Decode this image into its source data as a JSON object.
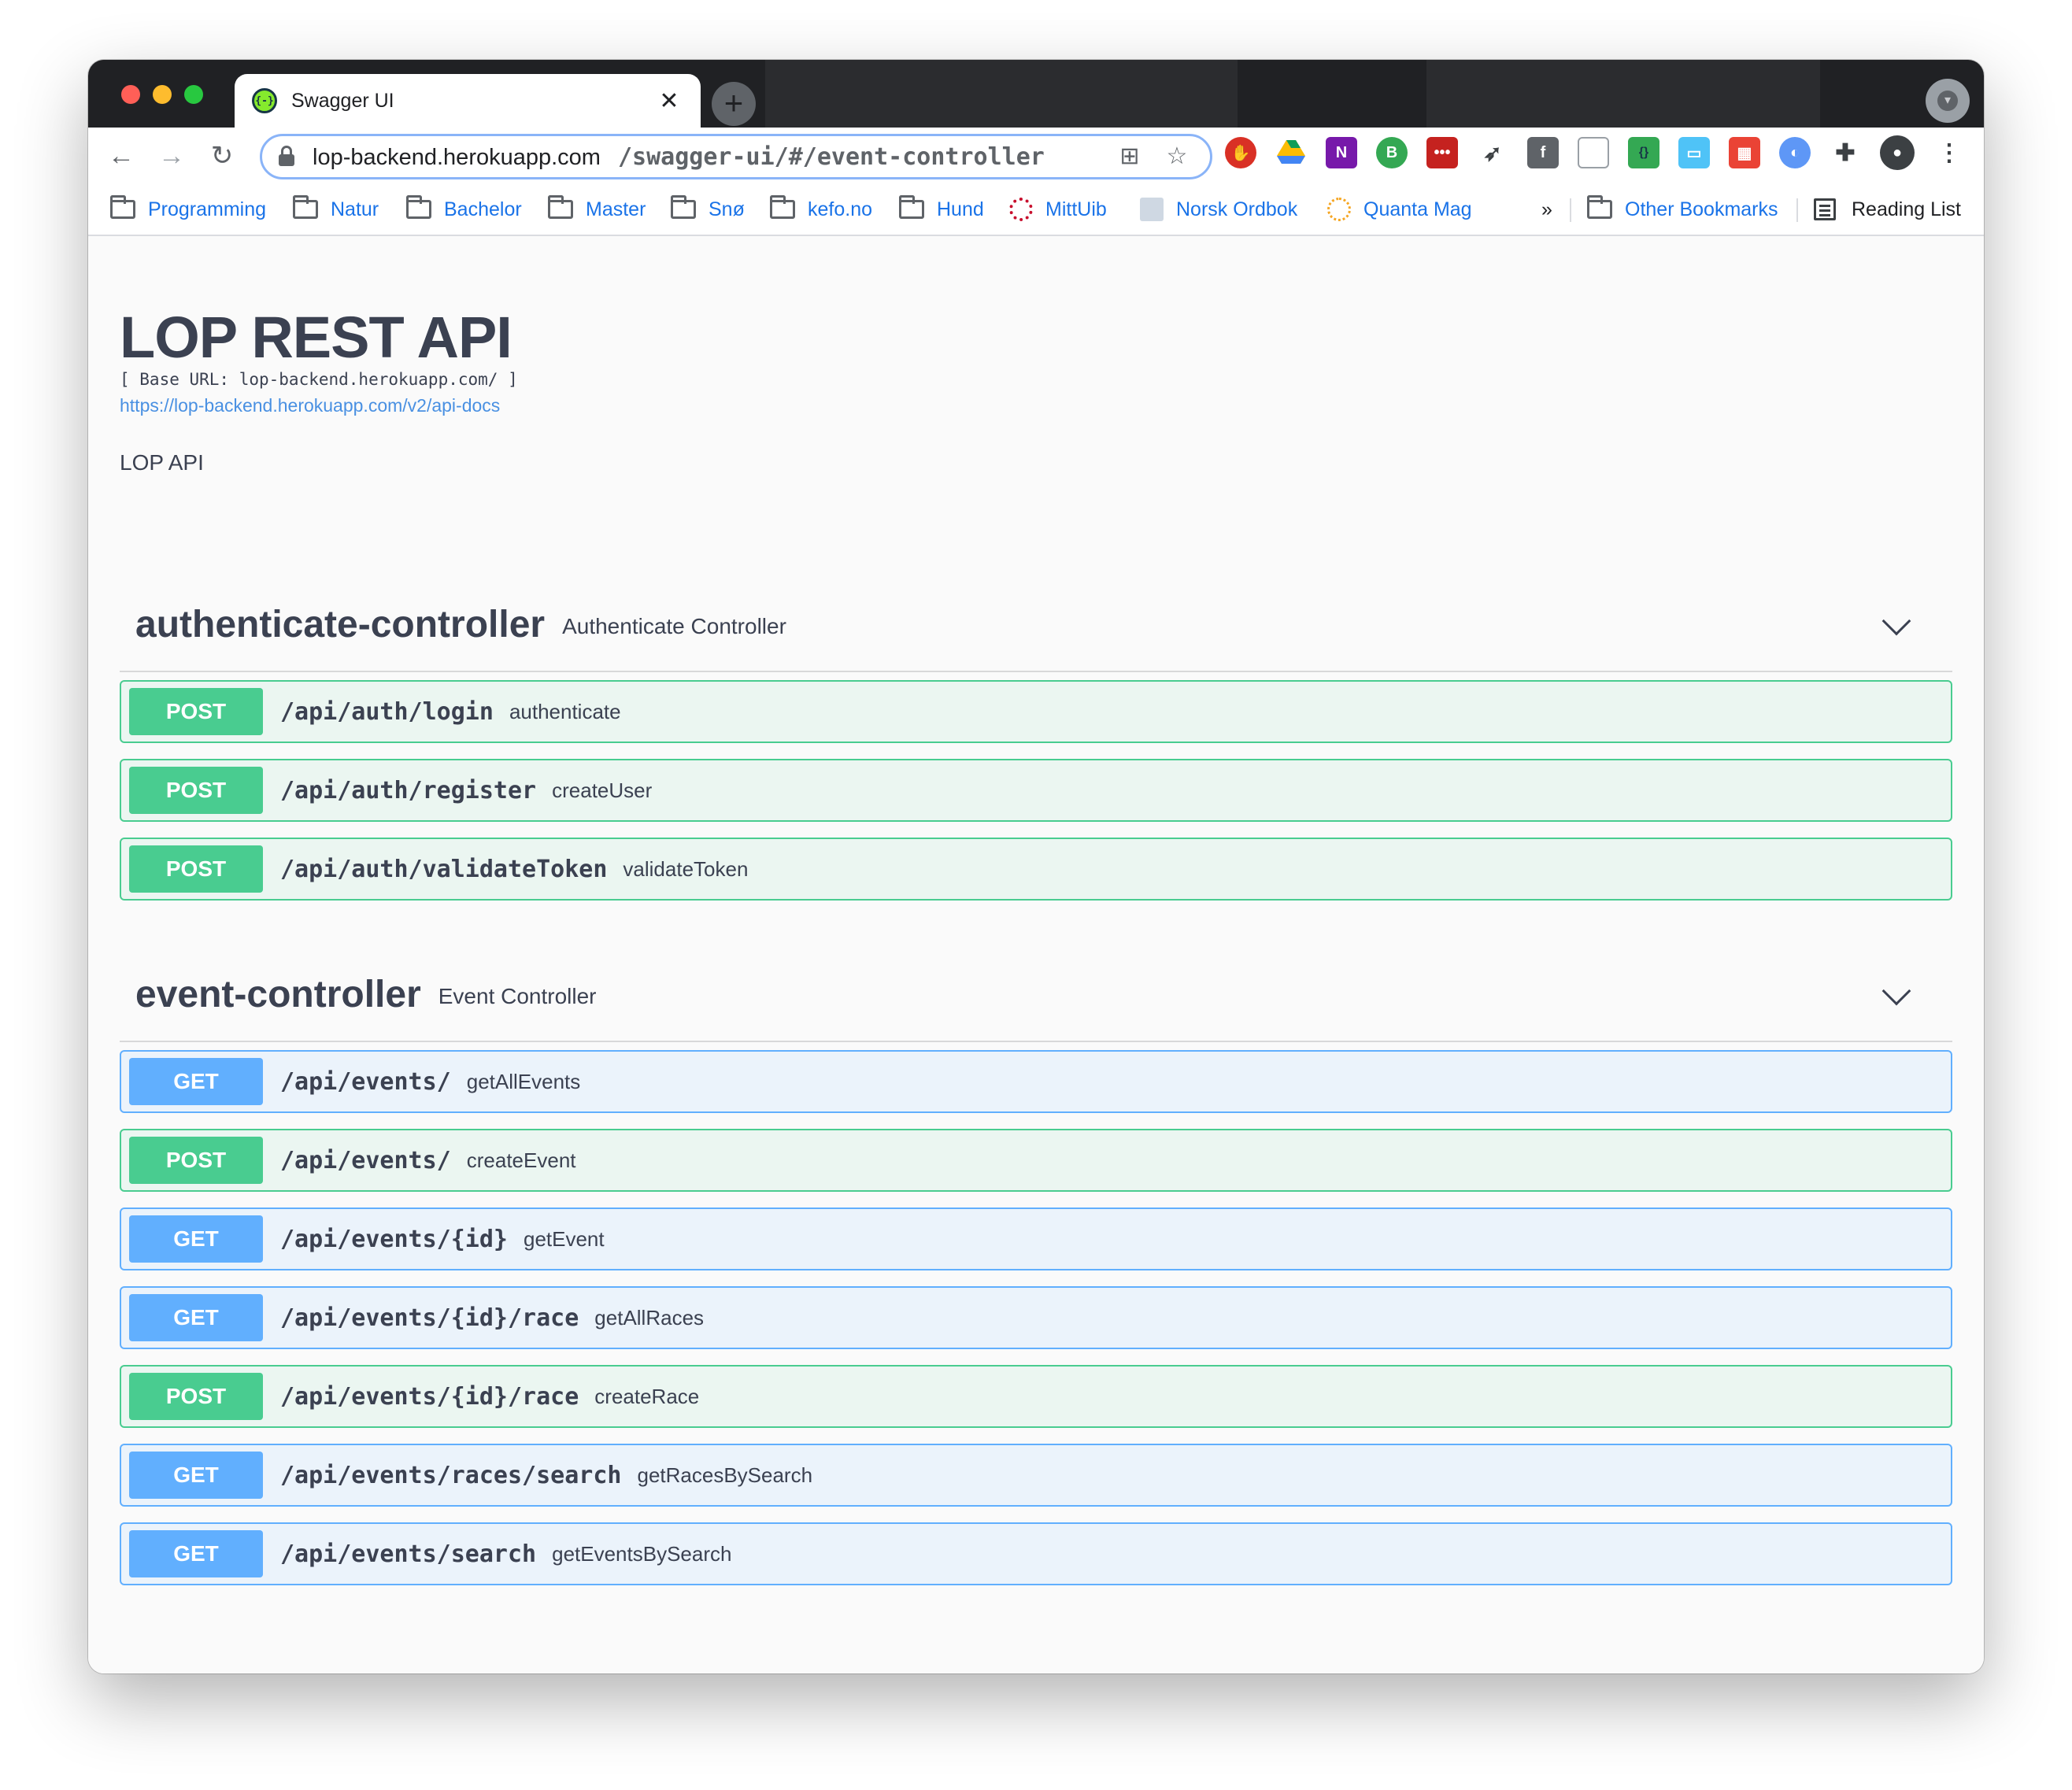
{
  "tab": {
    "title": "Swagger UI",
    "favicon": "{-}"
  },
  "address_bar": {
    "host": "lop-backend.herokuapp.com",
    "path": "/swagger-ui/#/event-controller"
  },
  "bookmarks": [
    {
      "label": "Programming",
      "icon": "folder-icon"
    },
    {
      "label": "Natur",
      "icon": "folder-icon"
    },
    {
      "label": "Bachelor",
      "icon": "folder-icon"
    },
    {
      "label": "Master",
      "icon": "folder-icon"
    },
    {
      "label": "Snø",
      "icon": "folder-icon"
    },
    {
      "label": "kefo.no",
      "icon": "folder-icon"
    },
    {
      "label": "Hund",
      "icon": "folder-icon"
    },
    {
      "label": "MittUib",
      "icon": "mittuib-icon"
    },
    {
      "label": "Norsk Ordbok",
      "icon": "ordbok-icon"
    },
    {
      "label": "Quanta Mag",
      "icon": "quanta-icon"
    }
  ],
  "bookmarks_overflow": "»",
  "other_bookmarks": "Other Bookmarks",
  "reading_list": "Reading List",
  "api": {
    "title": "LOP REST API",
    "base_url": "[ Base URL: lop-backend.herokuapp.com/ ]",
    "docs_link": "https://lop-backend.herokuapp.com/v2/api-docs",
    "description": "LOP API"
  },
  "sections": [
    {
      "name": "authenticate-controller",
      "description": "Authenticate Controller",
      "operations": [
        {
          "method": "POST",
          "path": "/api/auth/login",
          "summary": "authenticate"
        },
        {
          "method": "POST",
          "path": "/api/auth/register",
          "summary": "createUser"
        },
        {
          "method": "POST",
          "path": "/api/auth/validateToken",
          "summary": "validateToken"
        }
      ]
    },
    {
      "name": "event-controller",
      "description": "Event Controller",
      "operations": [
        {
          "method": "GET",
          "path": "/api/events/",
          "summary": "getAllEvents"
        },
        {
          "method": "POST",
          "path": "/api/events/",
          "summary": "createEvent"
        },
        {
          "method": "GET",
          "path": "/api/events/{id}",
          "summary": "getEvent"
        },
        {
          "method": "GET",
          "path": "/api/events/{id}/race",
          "summary": "getAllRaces"
        },
        {
          "method": "POST",
          "path": "/api/events/{id}/race",
          "summary": "createRace"
        },
        {
          "method": "GET",
          "path": "/api/events/races/search",
          "summary": "getRacesBySearch"
        },
        {
          "method": "GET",
          "path": "/api/events/search",
          "summary": "getEventsBySearch"
        }
      ]
    }
  ],
  "colors": {
    "post": "#49cc90",
    "get": "#61affe",
    "text": "#3b4151",
    "link": "#4990e2"
  }
}
